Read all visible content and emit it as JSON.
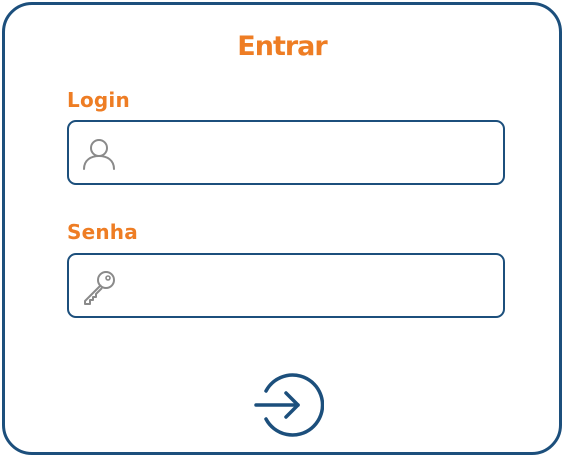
{
  "form": {
    "title": "Entrar",
    "login": {
      "label": "Login",
      "value": "",
      "placeholder": "",
      "icon": "user-icon"
    },
    "senha": {
      "label": "Senha",
      "value": "",
      "placeholder": "",
      "icon": "key-icon"
    },
    "submit_icon": "sign-in-icon"
  },
  "colors": {
    "accent": "#ee7d24",
    "border": "#1c4f7c",
    "icon_gray": "#8a8a8a"
  }
}
